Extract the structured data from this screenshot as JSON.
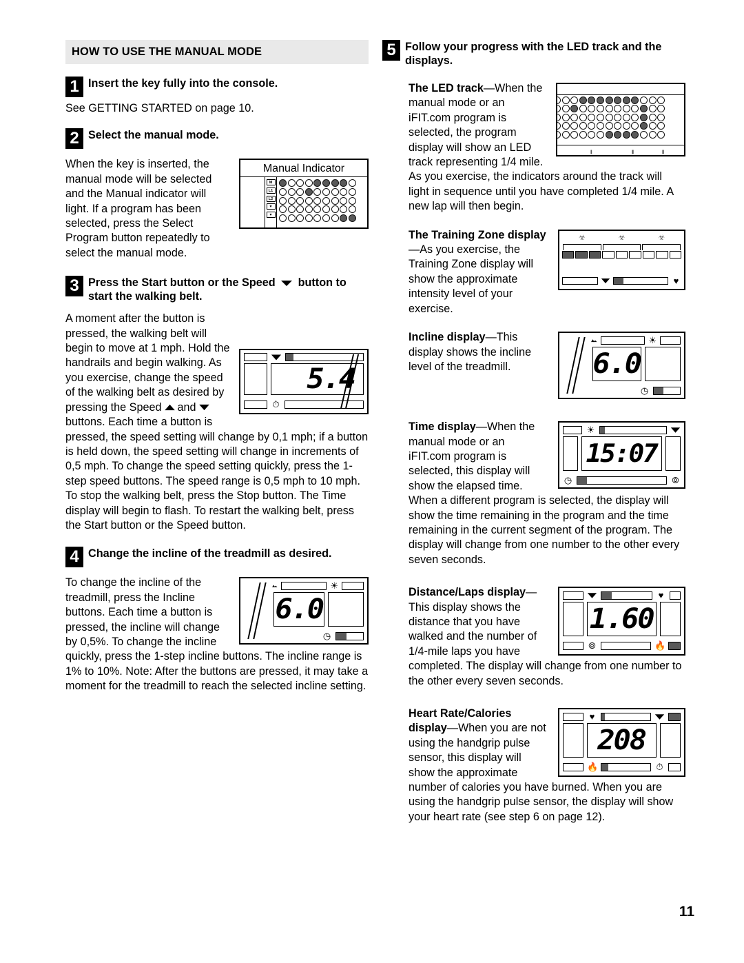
{
  "page": {
    "number": "11"
  },
  "left_column": {
    "section_title": "HOW TO USE THE MANUAL MODE",
    "step1": {
      "num": "1",
      "heading": "Insert the key fully into the console.",
      "body": "See GETTING STARTED on page 10."
    },
    "step2": {
      "num": "2",
      "heading": "Select the manual mode.",
      "body": "When the key is inserted, the manual mode will be selected and the Manual indicator will light. If a program has been selected, press the Select Program button repeatedly to select the manual mode.",
      "figure": {
        "title": "Manual Indicator",
        "row_labels": [
          "M",
          "L1",
          "L2",
          "♥",
          "♥"
        ]
      }
    },
    "step3": {
      "num": "3",
      "heading_part1": "Press the Start button or the Speed",
      "heading_part2": "button to start the walking belt.",
      "body1": "A moment after the button is pressed, the walking belt will begin to move at 1 mph. Hold the handrails and begin walking. As you exercise, change the speed of the walking belt as desired by pressing the Speed",
      "body1b": "and",
      "body1c": "buttons. Each time a button is pressed, the speed setting will change by 0,1 mph; if a button is held down, the speed setting will change in increments of 0,5 mph. To change the speed setting quickly, press the 1-step speed buttons. The speed range is 0,5 mph to 10 mph.",
      "body2": "To stop the walking belt, press the Stop button. The Time display will begin to flash. To restart the walking belt, press the Start button or the Speed button.",
      "figure": {
        "value": "5.4"
      }
    },
    "step4": {
      "num": "4",
      "heading": "Change the incline of the treadmill as desired.",
      "body": "To change the incline of the treadmill, press the Incline buttons. Each time a button is pressed, the incline will change by 0,5%. To change the incline quickly, press the 1-step incline buttons. The incline range is 1% to 10%. Note: After the buttons are pressed, it may take a moment for the treadmill to reach the selected incline setting.",
      "figure": {
        "value": "6.0"
      }
    }
  },
  "right_column": {
    "step5": {
      "num": "5",
      "heading": "Follow your progress with the LED track and the displays."
    },
    "led_track": {
      "lead": "The LED track",
      "dash": "—",
      "body": "When the manual mode or an iFIT.com program is selected, the program display will show an LED track representing 1/4 mile. As you exercise, the indicators around the track will light in sequence until you have completed 1/4 mile. A new lap will then begin."
    },
    "training_zone": {
      "lead": "The Training Zone display",
      "dash": "—",
      "body": "As you exercise, the Training Zone display will show the approximate intensity level of your exercise."
    },
    "incline": {
      "lead": "Incline display",
      "dash": "—",
      "body": "This display shows the incline level of the treadmill.",
      "figure": {
        "value": "6.0"
      }
    },
    "time": {
      "lead": "Time display",
      "dash": "—",
      "body": "When the manual mode or an iFIT.com program is selected, this display will show the elapsed time. When a different program is selected, the display will show the time remaining in the program and the time remaining in the current segment of the program. The display will change from one number to the other every seven seconds.",
      "figure": {
        "value": "15:07"
      }
    },
    "distance": {
      "lead": "Distance/Laps display",
      "dash": "—",
      "body": "This display shows the distance that you have walked and the number of 1/4-mile laps you have completed. The display will change from one number to the other every seven seconds.",
      "figure": {
        "value": "1.60"
      }
    },
    "heart_rate": {
      "lead": "Heart Rate/Calories display",
      "dash": "—",
      "body": "When you are not using the handgrip pulse sensor, this display will show the approximate number of calories you have burned. When you are using the handgrip pulse sensor, the display will show your heart rate (see step 6 on page 12).",
      "figure": {
        "value": "208"
      }
    }
  },
  "icons": {
    "speed": "speed-icon",
    "incline": "incline-mountain-icon",
    "clock": "clock-icon",
    "pulse": "pulse-icon",
    "heart": "heart-icon",
    "flame": "flame-icon",
    "laps": "laps-icon"
  }
}
